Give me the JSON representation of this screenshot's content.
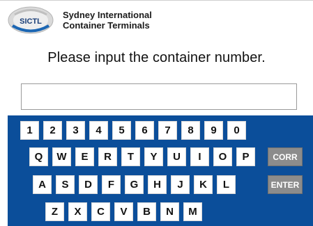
{
  "header": {
    "logo_text": "SICTL",
    "company_line1": "Sydney International",
    "company_line2": "Container Terminals"
  },
  "prompt": "Please input the container number.",
  "input": {
    "value": "",
    "placeholder": ""
  },
  "keyboard": {
    "number_row": [
      "1",
      "2",
      "3",
      "4",
      "5",
      "6",
      "7",
      "8",
      "9",
      "0"
    ],
    "row1": [
      "Q",
      "W",
      "E",
      "R",
      "T",
      "Y",
      "U",
      "I",
      "O",
      "P"
    ],
    "row2": [
      "A",
      "S",
      "D",
      "F",
      "G",
      "H",
      "J",
      "K",
      "L"
    ],
    "row3": [
      "Z",
      "X",
      "C",
      "V",
      "B",
      "N",
      "M"
    ],
    "corr_label": "CORR",
    "enter_label": "ENTER"
  },
  "colors": {
    "keyboard_bg": "#0b4e9a",
    "function_key_bg": "#8c8c8c",
    "logo_blue": "#1b66b3"
  }
}
